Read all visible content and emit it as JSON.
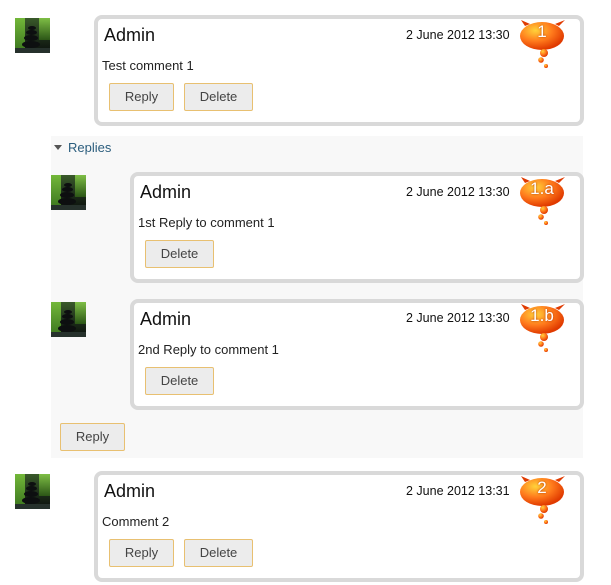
{
  "comments": [
    {
      "author": "Admin",
      "date": "2 June 2012 13:30",
      "text": "Test comment 1",
      "badge": "1",
      "reply_label": "Reply",
      "delete_label": "Delete"
    },
    {
      "author": "Admin",
      "date": "2 June 2012 13:31",
      "text": "Comment 2",
      "badge": "2",
      "reply_label": "Reply",
      "delete_label": "Delete"
    }
  ],
  "replies": {
    "toggle_label": "Replies",
    "items": [
      {
        "author": "Admin",
        "date": "2 June 2012 13:30",
        "text": "1st Reply to comment 1",
        "badge": "1.a",
        "delete_label": "Delete"
      },
      {
        "author": "Admin",
        "date": "2 June 2012 13:30",
        "text": "2nd Reply to comment 1",
        "badge": "1.b",
        "delete_label": "Delete"
      }
    ],
    "reply_label": "Reply"
  },
  "colors": {
    "badge_fill": "#ff7a1c",
    "badge_dark": "#e03a00",
    "box_border": "#d9d9d9",
    "button_border": "#e8c071"
  }
}
